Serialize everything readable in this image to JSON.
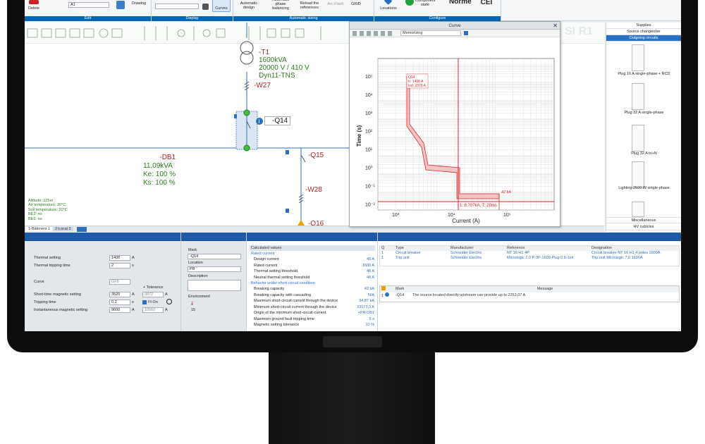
{
  "ribbon": {
    "delete": "Delete",
    "mark_value": "A1",
    "drawing": "Drawing",
    "curves": "Curves",
    "auto_design": "Automatic design",
    "auto_balancing": "Automatic phase balancing",
    "reload_refs": "Reload the references",
    "arc_flash": "Arc Flash",
    "grid": "GRID",
    "locations": "Locations",
    "component_state": "Component state",
    "norme": "Norme",
    "cei": "CEI",
    "groups": [
      "Edit",
      "Display",
      "Automatic sizing",
      "Configure"
    ]
  },
  "drawing": {
    "transformer": [
      "-T1",
      "1600kVA",
      "20000 V / 410 V",
      "Dyn11-TNS"
    ],
    "cable_w27": "-W27",
    "breaker_q14": "-Q14",
    "db1": "-DB1",
    "db1_values": [
      "11,09kVA",
      "Ke: 100 %",
      "Ks: 100 %"
    ],
    "q15": "-Q15",
    "w28": "-W28",
    "q16": "-Q16",
    "env": [
      "Altitude: 125m",
      "Air temperature: 30°C",
      "Soil temperature: 20°C",
      "BE2: no",
      "BE3: no"
    ],
    "sheet_tabs": [
      "1-Bâtiment 1",
      "2-Local 2"
    ],
    "watermark": "SI R1"
  },
  "curve": {
    "title": "Curve",
    "memorizing": "Memorizing",
    "ylabel": "Time (s)",
    "xlabel": "Current (A)",
    "tooltip": [
      "Q14",
      "Ir: 1408 A",
      "Isd: 3379 A"
    ],
    "marker_label": "42 kA",
    "point_label": "1: 8,707kA, T: 20ms",
    "xticks": [
      "10³",
      "10⁴",
      "10⁵"
    ],
    "yticks": [
      "10⁵",
      "10⁴",
      "10³",
      "10²",
      "10¹",
      "10⁰",
      "10⁻¹",
      "10⁻²"
    ]
  },
  "rpanel": {
    "headers": [
      "Supplies",
      "Source changeover",
      "Outgoing circuits"
    ],
    "items": [
      "Plug 16 A single-phase + RCD",
      "Plug 32 A single-phase",
      "Plug 32 A tri+N",
      "Lighting 2500 W single-phase"
    ],
    "footers": [
      "Miscellaneous",
      "HV cubicles"
    ]
  },
  "settings": {
    "thermal_setting": "Thermal setting",
    "thermal_value": "1408",
    "thermal_unit": "A",
    "thermal_time": "Thermal tripping time",
    "thermal_time_value": "2",
    "thermal_time_unit": "s",
    "curve": "Curve",
    "curve_value": "GF8",
    "tolerance": "+ Tolerance",
    "short_time": "Short-time magnetic setting",
    "short_time_value": "3520",
    "short_time_tol": "3872",
    "tripping_time": "Tripping time",
    "tripping_value": "0,2",
    "i2t_on": "I²t On",
    "inst_mag": "Instantaneous magnetic setting",
    "inst_value": "9600",
    "inst_tol": "10560",
    "unit_a": "A",
    "unit_s": "s"
  },
  "mark": {
    "mark_label": "Mark",
    "mark_value": "-Q14",
    "location_label": "Location",
    "location_value": "PR",
    "description_label": "Description",
    "environment_label": "Environment",
    "environment_value": "15"
  },
  "calc": {
    "header": "Calculated values",
    "sections": [
      {
        "title": "Rated current",
        "rows": [
          [
            "Design current",
            "48 A"
          ],
          [
            "Rated current",
            "1600 A"
          ],
          [
            "Thermal setting threshold",
            "48 A"
          ],
          [
            "Neutral thermal setting threshold",
            "48 A"
          ]
        ]
      },
      {
        "title": "Behavior under short-circuit condition",
        "rows": [
          [
            "Breaking capacity",
            "42 kA"
          ],
          [
            "Breaking capacity with cascading",
            "N/A"
          ],
          [
            "Maximum short-circuit current through the device",
            "34,87 kA"
          ],
          [
            "Minimum short-circuit current through the device",
            "23173,3 A"
          ],
          [
            "Origin of the minimum short-circuit current",
            "+PR-DB1"
          ],
          [
            "Maximum ground fault tripping time",
            "5 s"
          ],
          [
            "Magnetic setting tolerance",
            "10 %"
          ]
        ]
      }
    ]
  },
  "components": {
    "headers": [
      "Q",
      "Type",
      "Manufacturer",
      "Reference",
      "Designation"
    ],
    "rows": [
      [
        "1",
        "Circuit breaker",
        "Schneider Electric",
        "NT 16 H1 4P",
        "Circuit breaker NT 16 H1 4 poles 1600A"
      ],
      [
        "1",
        "Trip unit",
        "Schneider Electric",
        "Micrologic 7.0 P-3P-1600-Plug 0.8-1xIr",
        "Trip unit Micrologic 7.0 1600A"
      ]
    ]
  },
  "messages": {
    "headers": [
      "Mark",
      "Message"
    ],
    "rows": [
      [
        "1",
        "-Q14",
        "The source located directly upstream can provide up to 2253,07 A"
      ]
    ]
  },
  "colors": {
    "accent": "#0067b8",
    "trip_curve": "#d9252a",
    "wire": "#2a6fc0",
    "mark_red": "#b22222",
    "value_green": "#2e7d20"
  }
}
